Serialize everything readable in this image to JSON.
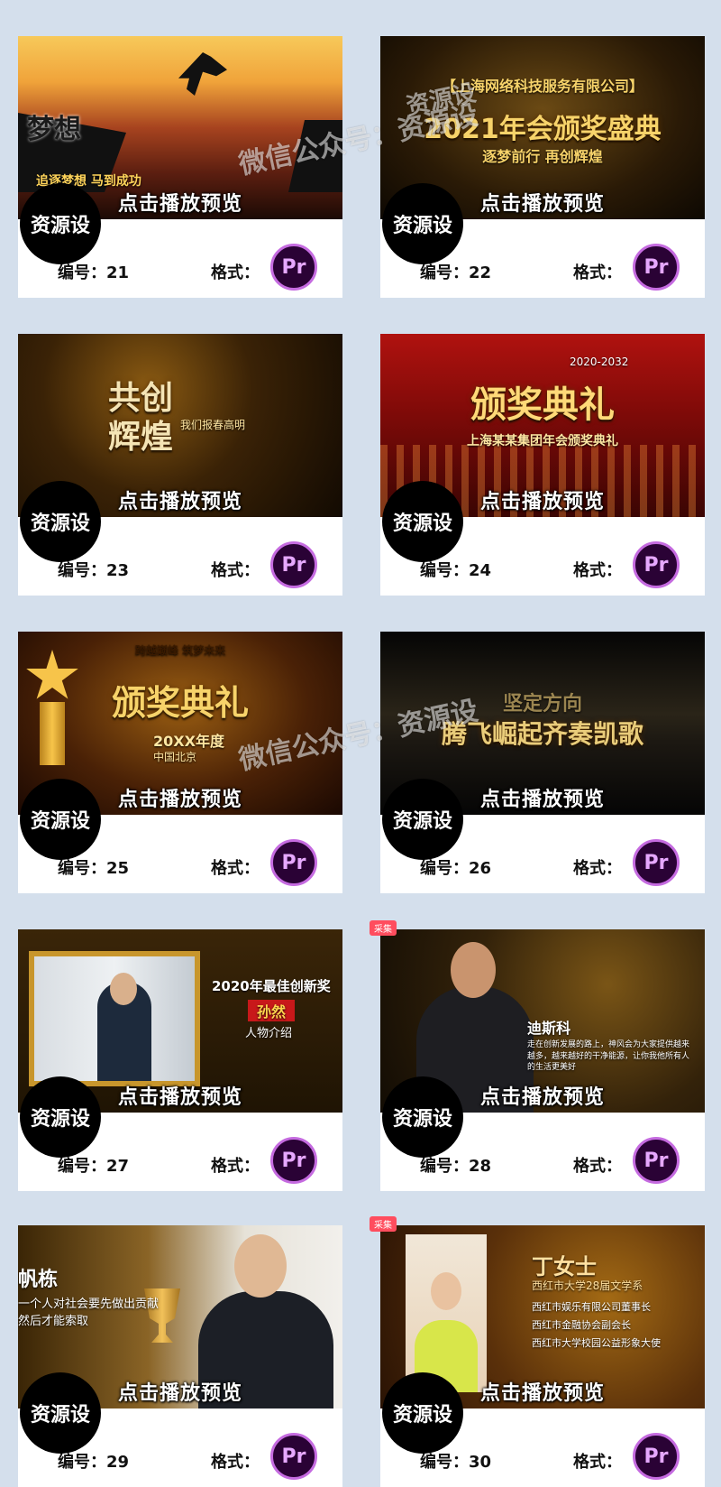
{
  "watermark": {
    "text_a": "微信公众号：资源设",
    "text_b": "资源设"
  },
  "labels": {
    "preview": "点击播放预览",
    "badge": "资源设",
    "number": "编号：",
    "format": "格式：",
    "pr": "Pr",
    "favorite": "采集"
  },
  "colors": {
    "accent_gold": "#f7d36a",
    "pr_border": "#c56be0",
    "pr_bg": "#2a0235",
    "fav_red": "#ff4d5e",
    "page_bg": "#d4dfec"
  },
  "cards": [
    {
      "number": "21",
      "title": "梦想",
      "subtitle": "追逐梦想 马到成功"
    },
    {
      "number": "22",
      "title": "2021年会颁奖盛典",
      "subtitle": "【上海网络科技服务有限公司】",
      "caption": "逐梦前行 再创辉煌"
    },
    {
      "number": "23",
      "title": "共创辉煌",
      "subtitle": "我们报春高明"
    },
    {
      "number": "24",
      "title": "颁奖典礼",
      "subtitle": "上海某某集团年会颁奖典礼",
      "caption": "2020-2032"
    },
    {
      "number": "25",
      "title": "颁奖典礼",
      "subtitle": "20XX年度",
      "caption": "中国北京",
      "banner": "跨越巅峰 筑梦未来"
    },
    {
      "number": "26",
      "title": "腾飞崛起齐奏凯歌",
      "subtitle": "坚定方向"
    },
    {
      "number": "27",
      "title": "2020年最佳创新奖",
      "subtitle": "孙然",
      "caption": "人物介绍"
    },
    {
      "number": "28",
      "title": "迪斯科",
      "subtitle": "走在创新发展的路上，神风会为大家提供越来越多，越来越好的干净能源，让你我他所有人的生活更美好"
    },
    {
      "number": "29",
      "title": "帆栋",
      "subtitle": "一个人对社会要先做出贡献 然后才能索取"
    },
    {
      "number": "30",
      "title": "丁女士",
      "subtitle": "西红市大学28届文学系",
      "lines": [
        "西红市娱乐有限公司董事长",
        "西红市金融协会副会长",
        "西红市大学校园公益形象大使"
      ]
    }
  ]
}
